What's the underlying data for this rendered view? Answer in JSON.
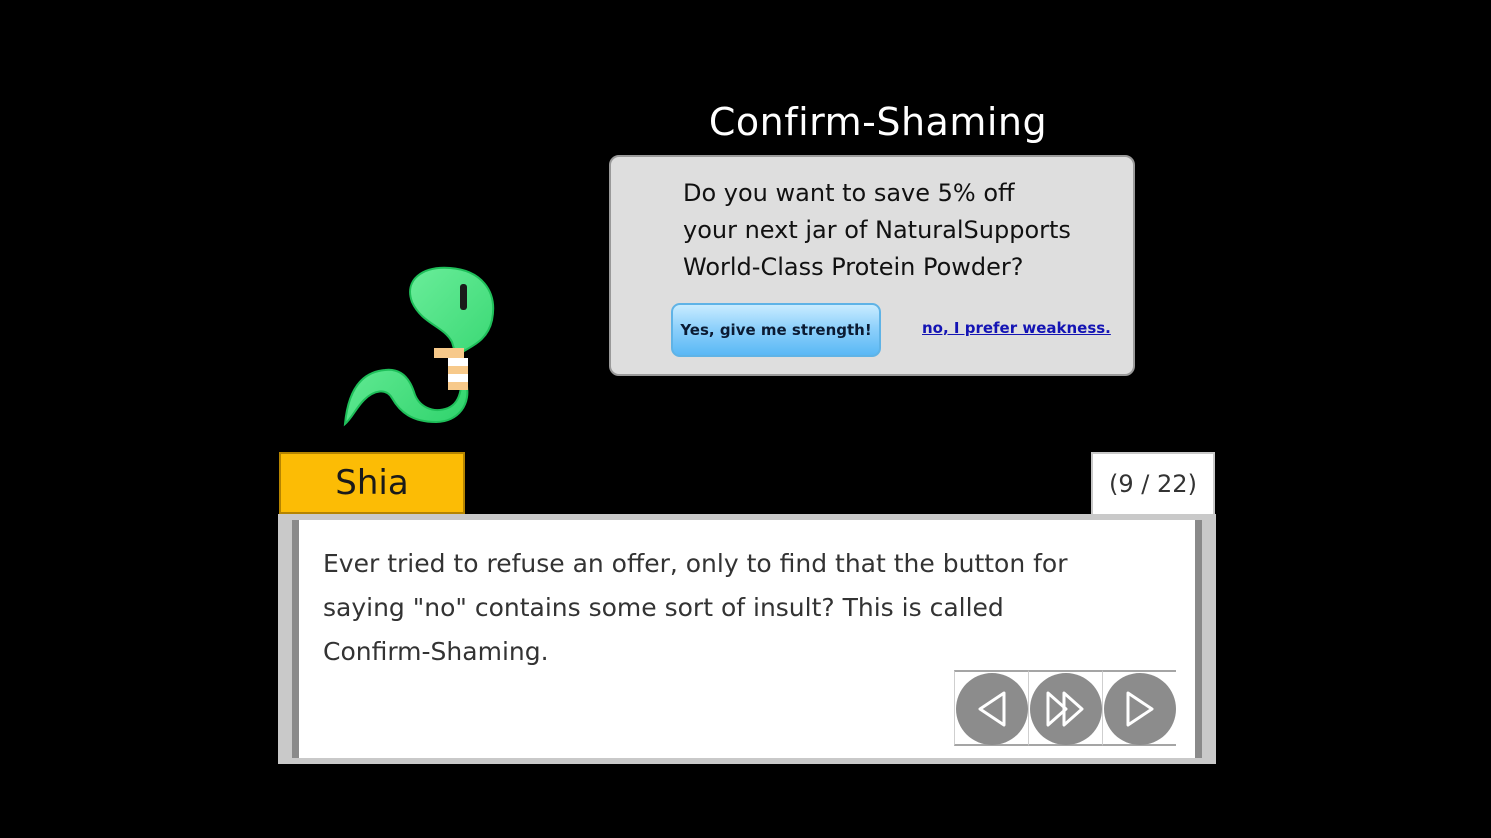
{
  "scene": {
    "title": "Confirm-Shaming"
  },
  "popup": {
    "lines": [
      "Do you want to save 5% off",
      "your next jar of NaturalSupports",
      "World-Class Protein Powder?"
    ],
    "yes_label": "Yes, give me strength!",
    "no_label": "no, I prefer weakness."
  },
  "speaker": {
    "name": "Shia"
  },
  "progress": {
    "label": "(9 / 22)",
    "current": 9,
    "total": 22
  },
  "dialog": {
    "lines": [
      "Ever tried to refuse an offer, only to find that the button for",
      "saying \"no\" contains some sort of insult? This is called",
      "Confirm-Shaming."
    ]
  },
  "controls": {
    "icons": [
      "back-icon",
      "fast-forward-icon",
      "next-icon"
    ]
  },
  "colors": {
    "name_tag": "#fcbc05",
    "character": "#3ee07a",
    "yes_button": "#8fd1fb",
    "no_link": "#1414b4",
    "control_circle": "#8c8c8c"
  }
}
